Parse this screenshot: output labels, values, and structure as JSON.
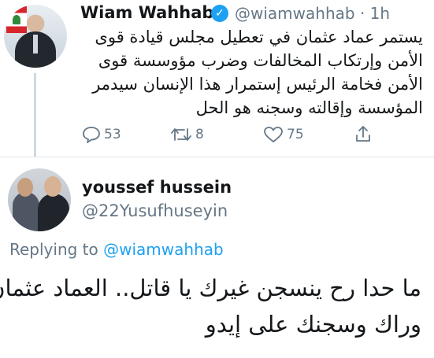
{
  "original_tweet": {
    "author_name": "Wiam Wahhab",
    "handle": "@wiamwahhab",
    "time": "· 1h",
    "lines": [
      "يستمر عماد عثمان في تعطيل مجلس قيادة قوى",
      "الأمن وإرتكاب المخالفات وضرب مؤوسسة قوى",
      "الأمن فخامة الرئيس إستمرار هذا الإنسان سيدمر",
      "المؤسسة وإقالته وسجنه هو الحل"
    ],
    "replies_count": "53",
    "retweets_count": "8",
    "likes_count": "75"
  },
  "reply": {
    "author_name": "youssef hussein",
    "handle": "@22Yusufhuseyin",
    "replying_prefix": "Replying to",
    "replying_to": "@wiamwahhab",
    "lines": [
      "ما حدا رح ينسجن غيرك يا قاتل.. العماد عثمان",
      "وراك وسجنك على إيدو"
    ]
  },
  "colors": {
    "verified": "#1da1f2",
    "link": "#1da1f2",
    "secondary_text": "#657786"
  }
}
